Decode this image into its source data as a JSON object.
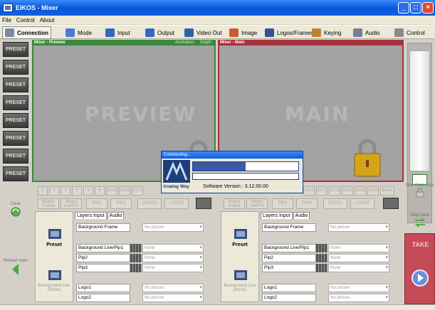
{
  "window": {
    "title": "EIKOS - Mixer"
  },
  "menu": [
    "File",
    "Control",
    "About"
  ],
  "toolbar": [
    {
      "label": "Connection",
      "icon": "monitor-icon",
      "color": "#7a8aa0",
      "active": true
    },
    {
      "label": "Mode",
      "icon": "mode-icon",
      "color": "#4a7ad8"
    },
    {
      "label": "Input",
      "icon": "input-icon",
      "color": "#2e69c6"
    },
    {
      "label": "Output",
      "icon": "output-icon",
      "color": "#2e69c6"
    },
    {
      "label": "Video Out",
      "icon": "video-out-icon",
      "color": "#2f5fa8"
    },
    {
      "label": "Image",
      "icon": "image-icon",
      "color": "#c85a34"
    },
    {
      "label": "Logos/Frames",
      "icon": "logos-icon",
      "color": "#33528f"
    },
    {
      "label": "Keying",
      "icon": "keying-icon",
      "color": "#c08030"
    },
    {
      "label": "Audio",
      "icon": "audio-icon",
      "color": "#7a7a9a"
    },
    {
      "label": "Control",
      "icon": "control-icon",
      "color": "#8a8a8a"
    }
  ],
  "preview": {
    "header": "Mixer - Preview",
    "links": [
      "Animation",
      "Depth"
    ],
    "screen_text": "PREVIEW"
  },
  "main": {
    "header": "Mixer - Main",
    "screen_text": "MAIN"
  },
  "sources_left": [
    "1",
    "2",
    "3",
    "4",
    "5",
    "6",
    "DVI1",
    "DVI2",
    "SDI1"
  ],
  "sources_right": [
    "DVI1",
    "DVI2",
    "SDI1",
    "SDI2",
    "SDI3",
    "SDI4",
    "Black"
  ],
  "layer_buttons_left": [
    "Bkgnd Frame",
    "Bkgnd Live/Pi1",
    "PIP2",
    "PIP3",
    "LOGO1",
    "LOGO2"
  ],
  "layer_buttons_right": [
    "Bkgnd Frame",
    "Bkgnd Live/Pi1",
    "PIP2",
    "PIP3",
    "LOGO1",
    "LOGO2"
  ],
  "side": {
    "clear": "Clear",
    "reload": "Reload main",
    "one_shot_lock": "One Shot Lock",
    "step_back": "Step back",
    "take": "TAKE"
  },
  "layers_left": {
    "tabs": [
      "Layers Input",
      "Audio"
    ],
    "preset_label": "Preset",
    "background_live_label": "Background Live (None)",
    "rows": [
      {
        "name": "Background Frame",
        "value": "No picture"
      },
      {
        "name": "Background Live/Pip1",
        "value": "None"
      },
      {
        "name": "Pip2",
        "value": "None"
      },
      {
        "name": "Pip3",
        "value": "None"
      },
      {
        "name": "Logo1",
        "value": "No picture"
      },
      {
        "name": "Logo2",
        "value": "No picture"
      }
    ]
  },
  "layers_right": {
    "tabs": [
      "Layers Input",
      "Audio"
    ],
    "preset_label": "Preset",
    "background_live_label": "Background Live (None)",
    "rows": [
      {
        "name": "Background Frame",
        "value": "No picture"
      },
      {
        "name": "Background Live/Pip1",
        "value": "None"
      },
      {
        "name": "Pip2",
        "value": "None"
      },
      {
        "name": "Pip3",
        "value": "None"
      },
      {
        "name": "Logo1",
        "value": "No picture"
      },
      {
        "name": "Logo2",
        "value": "No picture"
      }
    ]
  },
  "dialog": {
    "title": "Connecting...",
    "brand": "Analog Way",
    "version_text": "Software Version : 3.12.00.00",
    "progress": 0.5
  }
}
